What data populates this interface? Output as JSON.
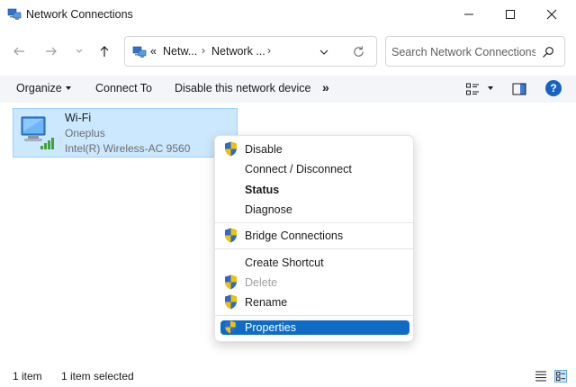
{
  "window": {
    "title": "Network Connections"
  },
  "navigation": {
    "address_overflow": "«",
    "breadcrumb": [
      "Netw...",
      "Network ..."
    ],
    "search_placeholder": "Search Network Connections"
  },
  "toolbar": {
    "organize": "Organize",
    "connect_to": "Connect To",
    "disable_device": "Disable this network device",
    "more": "»",
    "help": "?"
  },
  "connection": {
    "name": "Wi-Fi",
    "network": "Oneplus",
    "device": "Intel(R) Wireless-AC 9560"
  },
  "context_menu": {
    "disable": "Disable",
    "connect_disconnect": "Connect / Disconnect",
    "status": "Status",
    "diagnose": "Diagnose",
    "bridge": "Bridge Connections",
    "create_shortcut": "Create Shortcut",
    "delete": "Delete",
    "rename": "Rename",
    "properties": "Properties"
  },
  "statusbar": {
    "item_count": "1 item",
    "selected_count": "1 item selected"
  },
  "colors": {
    "selection_bg": "#cce8ff",
    "menu_highlight": "#0e6cc5",
    "toolbar_bg": "#f3f5f9",
    "help_blue": "#1764c0"
  }
}
